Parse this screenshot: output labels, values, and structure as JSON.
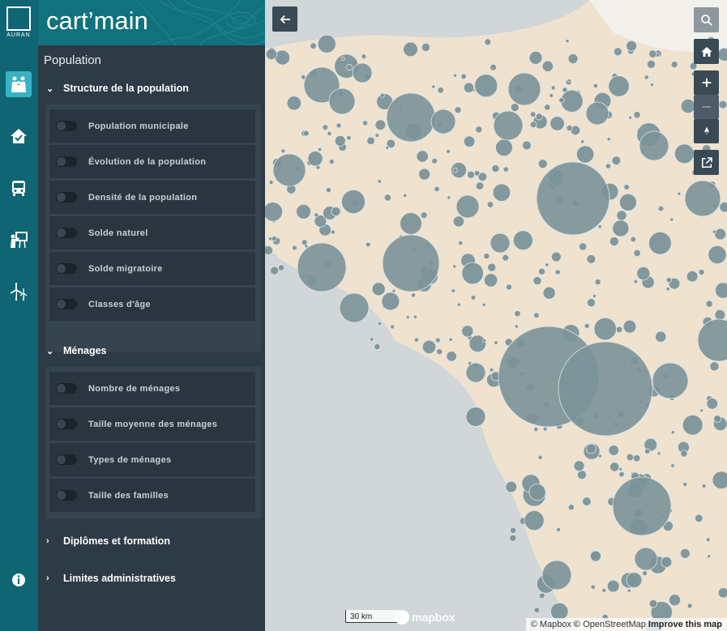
{
  "rail": {
    "logo_text": "AURAN",
    "items": [
      {
        "name": "population-icon",
        "active": true
      },
      {
        "name": "housing-icon",
        "active": false
      },
      {
        "name": "transport-icon",
        "active": false
      },
      {
        "name": "education-icon",
        "active": false
      },
      {
        "name": "energy-icon",
        "active": false
      }
    ],
    "info_icon": "info-icon"
  },
  "brand": {
    "title": "cart’main"
  },
  "panel": {
    "title": "Population",
    "sections": [
      {
        "label": "Structure de la population",
        "expanded": true,
        "items": [
          "Population municipale",
          "Évolution de la population",
          "Densité de la population",
          "Solde naturel",
          "Solde migratoire",
          "Classes d'âge"
        ]
      },
      {
        "label": "Ménages",
        "expanded": true,
        "items": [
          "Nombre de ménages",
          "Taille moyenne des ménages",
          "Types de ménages",
          "Taille des familles"
        ]
      },
      {
        "label": "Diplômes et formation",
        "expanded": false
      },
      {
        "label": "Limites administratives",
        "expanded": false
      }
    ]
  },
  "map": {
    "controls": [
      "back-arrow-icon",
      "search-icon",
      "home-icon",
      "zoom-in-icon",
      "zoom-out-icon",
      "compass-icon",
      "external-link-icon"
    ],
    "scale_label": "30 km",
    "logo_text": "mapbox",
    "attribution": "© Mapbox © OpenStreetMap",
    "improve_link": "Improve this map",
    "colors": {
      "land": "#efe2cf",
      "sea": "#d1d6d8",
      "bubble": "#7b9399"
    }
  }
}
